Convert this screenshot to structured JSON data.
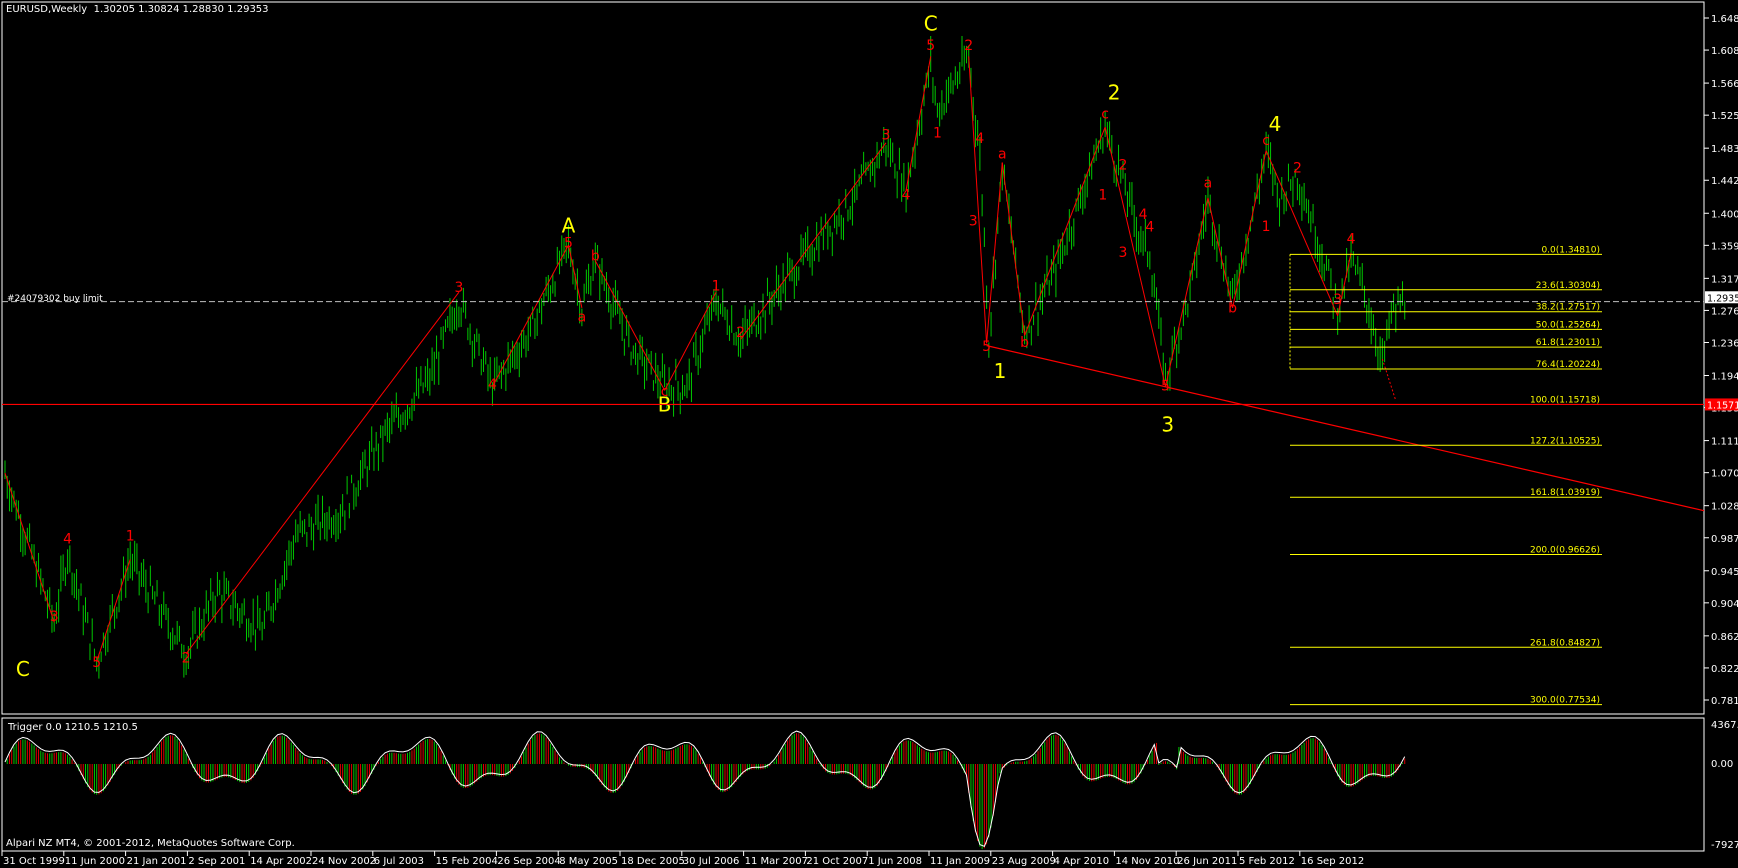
{
  "header": {
    "title": "EURUSD,Weekly  1.30205 1.30824 1.28830 1.29353"
  },
  "order_line": {
    "label": "#24079302 buy limit"
  },
  "indicator": {
    "title": "Trigger 0.0 1210.5 1210.5",
    "top_value": "4367.8",
    "zero_value": "0.00",
    "bottom_value": "-7927.2"
  },
  "footer": {
    "copyright": "Alpari NZ MT4, © 2001-2012, MetaQuotes Software Corp."
  },
  "price_axis": {
    "labels": [
      "1.64880",
      "1.60800",
      "1.56600",
      "1.52520",
      "1.48320",
      "1.44240",
      "1.40040",
      "1.35960",
      "1.31760",
      "1.27680",
      "1.23600",
      "1.19400",
      "1.15320",
      "1.11120",
      "1.07040",
      "1.02840",
      "0.98760",
      "0.94560",
      "0.90480",
      "0.86280",
      "0.82200",
      "0.78120"
    ],
    "current_price": "1.29353",
    "red_line_value": "1.15718"
  },
  "time_axis": {
    "labels": [
      "31 Oct 1999",
      "11 Jun 2000",
      "21 Jan 2001",
      "2 Sep 2001",
      "14 Apr 2002",
      "24 Nov 2002",
      "6 Jul 2003",
      "15 Feb 2004",
      "26 Sep 2004",
      "8 May 2005",
      "18 Dec 2005",
      "30 Jul 2006",
      "11 Mar 2007",
      "21 Oct 2007",
      "1 Jun 2008",
      "11 Jan 2009",
      "23 Aug 2009",
      "4 Apr 2010",
      "14 Nov 2010",
      "26 Jun 2011",
      "5 Feb 2012",
      "16 Sep 2012"
    ]
  },
  "fibonacci": [
    {
      "label": "0.0(1.34810)",
      "price": 1.3481
    },
    {
      "label": "23.6(1.30304)",
      "price": 1.30304
    },
    {
      "label": "38.2(1.27517)",
      "price": 1.27517
    },
    {
      "label": "50.0(1.25264)",
      "price": 1.25264
    },
    {
      "label": "61.8(1.23011)",
      "price": 1.23011
    },
    {
      "label": "76.4(1.20224)",
      "price": 1.20224
    },
    {
      "label": "100.0(1.15718)",
      "price": 1.15718
    },
    {
      "label": "127.2(1.10525)",
      "price": 1.10525
    },
    {
      "label": "161.8(1.03919)",
      "price": 1.03919
    },
    {
      "label": "200.0(0.96626)",
      "price": 0.96626
    },
    {
      "label": "261.8(0.84827)",
      "price": 0.84827
    },
    {
      "label": "300.0(0.77534)",
      "price": 0.77534
    }
  ],
  "wave_labels": {
    "major": [
      {
        "text": "C",
        "week": 8,
        "price": 0.812
      },
      {
        "text": "A",
        "week": 252,
        "price": 1.376
      },
      {
        "text": "B",
        "week": 295,
        "price": 1.148
      },
      {
        "text": "C",
        "week": 414,
        "price": 1.633
      },
      {
        "text": "1",
        "week": 445,
        "price": 1.191
      },
      {
        "text": "2",
        "week": 496,
        "price": 1.545
      },
      {
        "text": "3",
        "week": 520,
        "price": 1.123
      },
      {
        "text": "4",
        "week": 568,
        "price": 1.505
      }
    ],
    "minor": [
      {
        "text": "3",
        "week": 22,
        "price": 0.882
      },
      {
        "text": "4",
        "week": 28,
        "price": 0.98
      },
      {
        "text": "5",
        "week": 41,
        "price": 0.823
      },
      {
        "text": "1",
        "week": 56,
        "price": 0.984
      },
      {
        "text": "2",
        "week": 81,
        "price": 0.829
      },
      {
        "text": "3",
        "week": 203,
        "price": 1.3
      },
      {
        "text": "4",
        "week": 218,
        "price": 1.177
      },
      {
        "text": "5",
        "week": 252,
        "price": 1.357
      },
      {
        "text": "a",
        "week": 258,
        "price": 1.263
      },
      {
        "text": "b",
        "week": 264,
        "price": 1.34
      },
      {
        "text": "c",
        "week": 295,
        "price": 1.168
      },
      {
        "text": "1",
        "week": 318,
        "price": 1.302
      },
      {
        "text": "2",
        "week": 329,
        "price": 1.243
      },
      {
        "text": "3",
        "week": 394,
        "price": 1.494
      },
      {
        "text": "4",
        "week": 403,
        "price": 1.418
      },
      {
        "text": "5",
        "week": 414,
        "price": 1.608
      },
      {
        "text": "1",
        "week": 417,
        "price": 1.497
      },
      {
        "text": "2",
        "week": 431,
        "price": 1.608
      },
      {
        "text": "4",
        "week": 436,
        "price": 1.49
      },
      {
        "text": "3",
        "week": 433,
        "price": 1.385
      },
      {
        "text": "5",
        "week": 439,
        "price": 1.225
      },
      {
        "text": "a",
        "week": 446,
        "price": 1.47
      },
      {
        "text": "b",
        "week": 456,
        "price": 1.23
      },
      {
        "text": "c",
        "week": 492,
        "price": 1.521
      },
      {
        "text": "1",
        "week": 491,
        "price": 1.418
      },
      {
        "text": "2",
        "week": 500,
        "price": 1.456
      },
      {
        "text": "3",
        "week": 500,
        "price": 1.345
      },
      {
        "text": "4",
        "week": 512,
        "price": 1.377
      },
      {
        "text": "4",
        "week": 509,
        "price": 1.393
      },
      {
        "text": "5",
        "week": 519,
        "price": 1.175
      },
      {
        "text": "a",
        "week": 538,
        "price": 1.433
      },
      {
        "text": "b",
        "week": 549,
        "price": 1.274
      },
      {
        "text": "c",
        "week": 564,
        "price": 1.487
      },
      {
        "text": "1",
        "week": 564,
        "price": 1.378
      },
      {
        "text": "2",
        "week": 578,
        "price": 1.452
      },
      {
        "text": "3",
        "week": 596,
        "price": 1.285
      },
      {
        "text": "4",
        "week": 602,
        "price": 1.362
      }
    ]
  },
  "colors": {
    "background": "#000000",
    "bull_bar": "#00C800",
    "wave_line": "#FF0000",
    "major_label": "#FFFF00",
    "minor_label": "#FF0000",
    "fib_line": "#FFFF00",
    "grid_text": "#FFFFFF",
    "order_line": "#C0C0C0"
  }
}
